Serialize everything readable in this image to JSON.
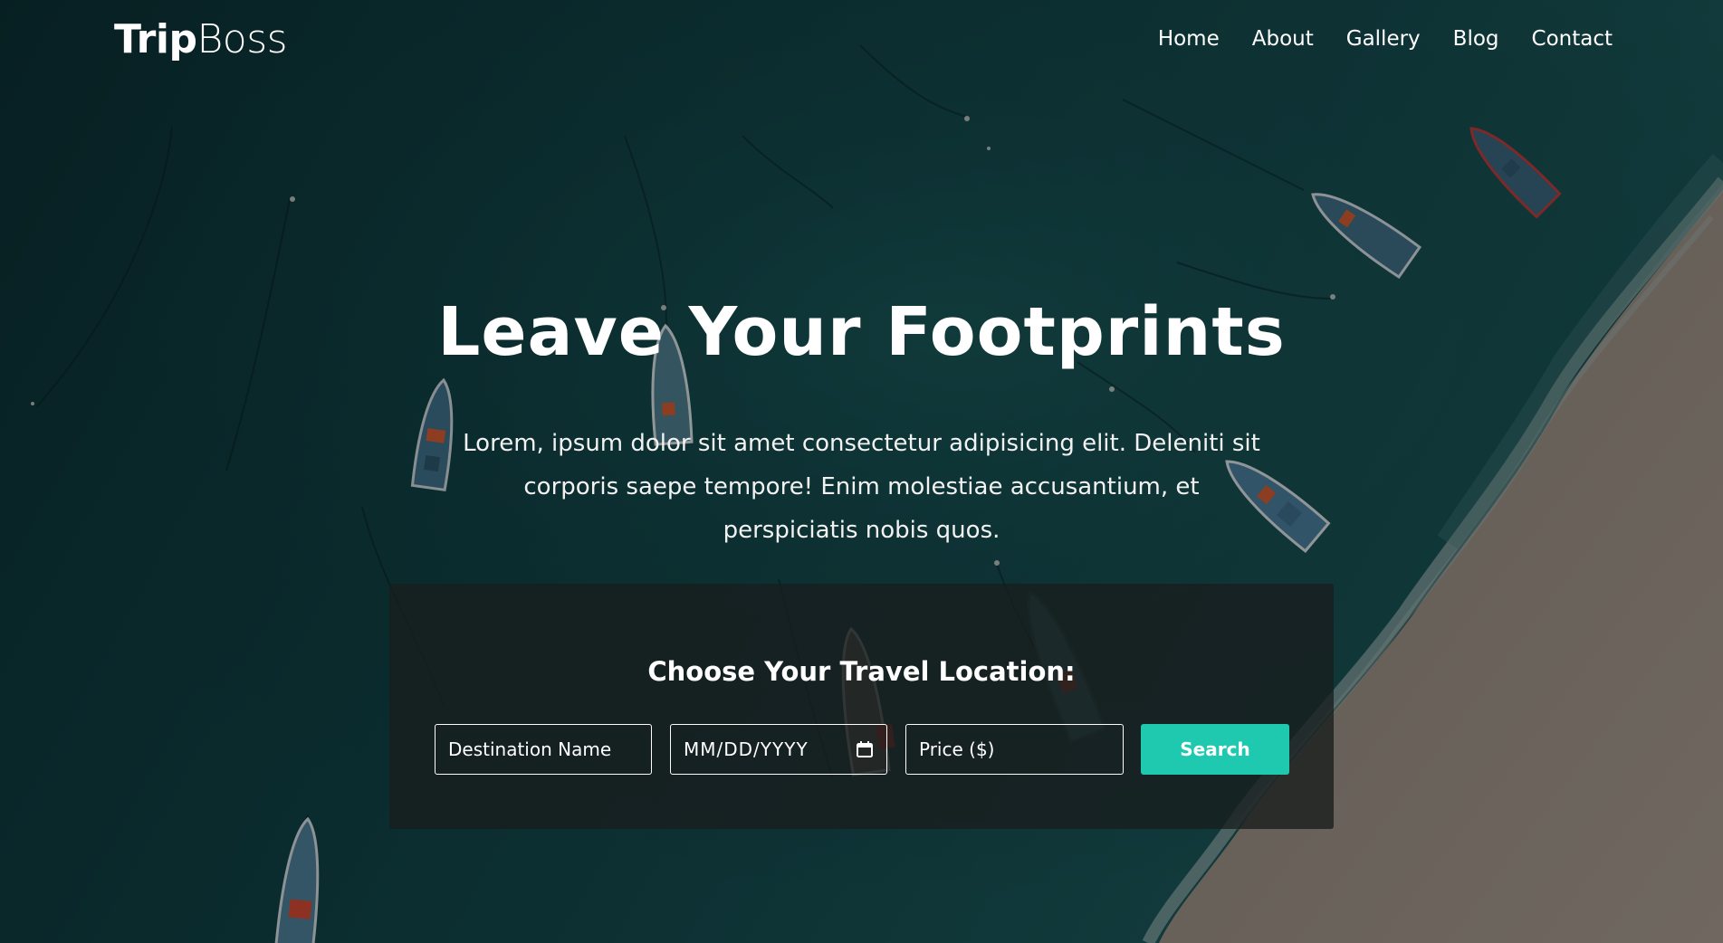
{
  "brand": {
    "name_bold": "Trip",
    "name_light": "Boss"
  },
  "nav": {
    "items": [
      {
        "label": "Home"
      },
      {
        "label": "About"
      },
      {
        "label": "Gallery"
      },
      {
        "label": "Blog"
      },
      {
        "label": "Contact"
      }
    ]
  },
  "hero": {
    "title": "Leave Your Footprints",
    "text": "Lorem, ipsum dolor sit amet consectetur adipisicing elit. Deleniti sit corporis saepe tempore! Enim molestiae accusantium, et perspiciatis nobis quos."
  },
  "search_panel": {
    "title": "Choose Your Travel Location:",
    "destination_placeholder": "Destination Name",
    "date_placeholder": "MM/DD/YYYY",
    "price_placeholder": "Price ($)",
    "search_label": "Search"
  },
  "colors": {
    "accent": "#1ec9b0",
    "sea": "#0e3a3c",
    "sand": "#c9b8a6",
    "panel": "#181e1e",
    "text": "#ffffff"
  },
  "icons": {
    "date_field": "calendar-icon"
  }
}
